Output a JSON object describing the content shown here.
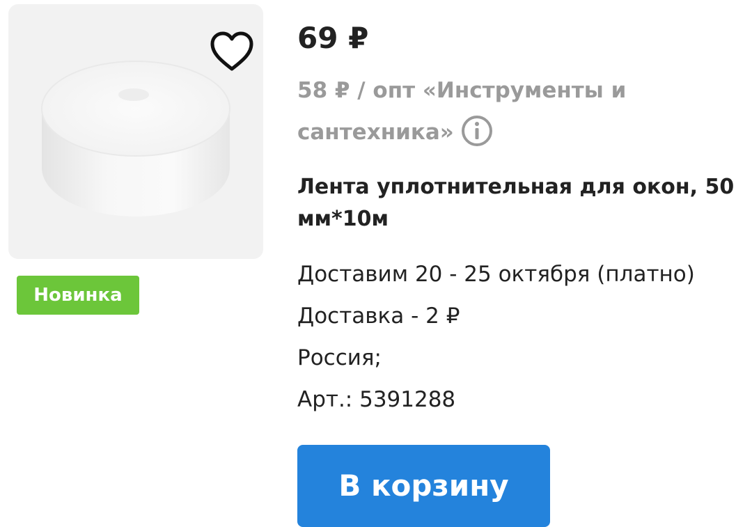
{
  "product": {
    "image_alt": "product-image",
    "badge": "Новинка",
    "price": "69 ₽",
    "wholesale_text": "58 ₽ / опт «Инструменты и сантехника»",
    "title": "Лента уплотнительная для окон, 50 мм*10м",
    "delivery_dates": "Доставим 20 - 25 октября (платно)",
    "delivery_cost": "Доставка - 2 ₽",
    "country": "Россия;",
    "article": "Арт.: 5391288",
    "cart_button": "В корзину"
  },
  "icons": {
    "favorite": "heart-icon",
    "info": "info-icon"
  },
  "colors": {
    "badge": "#6cc63a",
    "button": "#2483dc",
    "muted": "#9a9a9a"
  }
}
